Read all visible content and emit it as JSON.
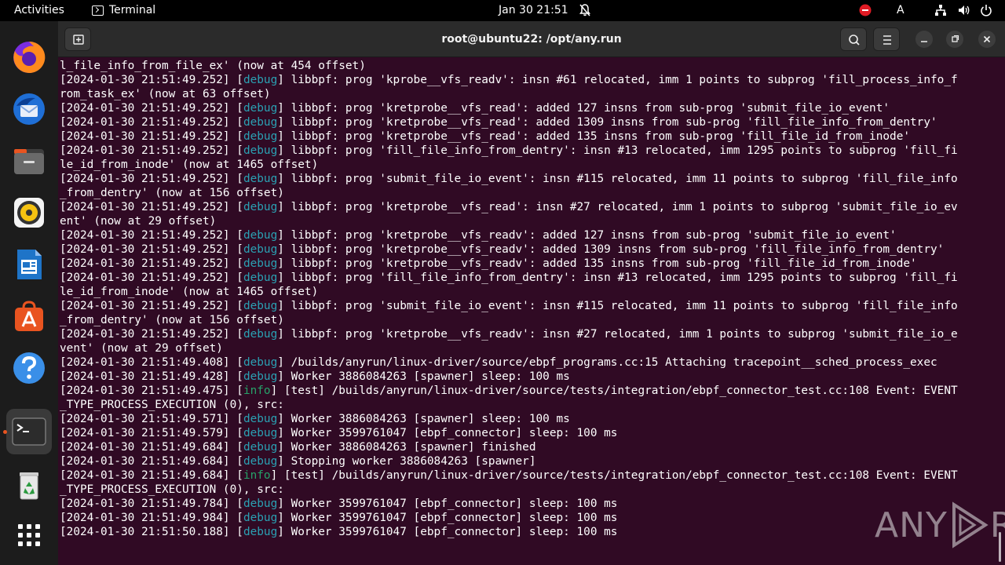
{
  "topbar": {
    "activities": "Activities",
    "app_name": "Terminal",
    "clock": "Jan 30  21:51",
    "icons": [
      "bell-icon",
      "status-red-icon",
      "input-method-icon",
      "network-icon",
      "volume-icon",
      "power-icon"
    ],
    "input_method": "A"
  },
  "dock": {
    "items": [
      {
        "name": "firefox",
        "icon": "firefox-icon"
      },
      {
        "name": "thunderbird",
        "icon": "thunderbird-icon"
      },
      {
        "name": "files",
        "icon": "files-icon"
      },
      {
        "name": "rhythmbox",
        "icon": "rhythmbox-icon"
      },
      {
        "name": "writer",
        "icon": "writer-icon"
      },
      {
        "name": "software",
        "icon": "software-center-icon"
      },
      {
        "name": "help",
        "icon": "help-icon"
      },
      {
        "name": "terminal",
        "icon": "terminal-icon",
        "active": true
      },
      {
        "name": "trash",
        "icon": "trash-icon"
      },
      {
        "name": "apps",
        "icon": "show-apps-icon"
      }
    ]
  },
  "window": {
    "title": "root@ubuntu22: /opt/any.run"
  },
  "colors": {
    "terminal_bg": "#300a24",
    "debug": "#2aa1b3",
    "info": "#26a269",
    "accent": "#e95420"
  },
  "terminal": {
    "lines": [
      {
        "plain": "l_file_info_from_file_ex' (now at 454 offset)"
      },
      {
        "ts": "[2024-01-30 21:51:49.252] ",
        "lvl": "debug",
        "msg": " libbpf: prog 'kprobe__vfs_readv': insn #61 relocated, imm 1 points to subprog 'fill_process_info_f"
      },
      {
        "plain": "rom_task_ex' (now at 63 offset)"
      },
      {
        "ts": "[2024-01-30 21:51:49.252] ",
        "lvl": "debug",
        "msg": " libbpf: prog 'kretprobe__vfs_read': added 127 insns from sub-prog 'submit_file_io_event'"
      },
      {
        "ts": "[2024-01-30 21:51:49.252] ",
        "lvl": "debug",
        "msg": " libbpf: prog 'kretprobe__vfs_read': added 1309 insns from sub-prog 'fill_file_info_from_dentry'"
      },
      {
        "ts": "[2024-01-30 21:51:49.252] ",
        "lvl": "debug",
        "msg": " libbpf: prog 'kretprobe__vfs_read': added 135 insns from sub-prog 'fill_file_id_from_inode'"
      },
      {
        "ts": "[2024-01-30 21:51:49.252] ",
        "lvl": "debug",
        "msg": " libbpf: prog 'fill_file_info_from_dentry': insn #13 relocated, imm 1295 points to subprog 'fill_fi"
      },
      {
        "plain": "le_id_from_inode' (now at 1465 offset)"
      },
      {
        "ts": "[2024-01-30 21:51:49.252] ",
        "lvl": "debug",
        "msg": " libbpf: prog 'submit_file_io_event': insn #115 relocated, imm 11 points to subprog 'fill_file_info"
      },
      {
        "plain": "_from_dentry' (now at 156 offset)"
      },
      {
        "ts": "[2024-01-30 21:51:49.252] ",
        "lvl": "debug",
        "msg": " libbpf: prog 'kretprobe__vfs_read': insn #27 relocated, imm 1 points to subprog 'submit_file_io_ev"
      },
      {
        "plain": "ent' (now at 29 offset)"
      },
      {
        "ts": "[2024-01-30 21:51:49.252] ",
        "lvl": "debug",
        "msg": " libbpf: prog 'kretprobe__vfs_readv': added 127 insns from sub-prog 'submit_file_io_event'"
      },
      {
        "ts": "[2024-01-30 21:51:49.252] ",
        "lvl": "debug",
        "msg": " libbpf: prog 'kretprobe__vfs_readv': added 1309 insns from sub-prog 'fill_file_info_from_dentry'"
      },
      {
        "ts": "[2024-01-30 21:51:49.252] ",
        "lvl": "debug",
        "msg": " libbpf: prog 'kretprobe__vfs_readv': added 135 insns from sub-prog 'fill_file_id_from_inode'"
      },
      {
        "ts": "[2024-01-30 21:51:49.252] ",
        "lvl": "debug",
        "msg": " libbpf: prog 'fill_file_info_from_dentry': insn #13 relocated, imm 1295 points to subprog 'fill_fi"
      },
      {
        "plain": "le_id_from_inode' (now at 1465 offset)"
      },
      {
        "ts": "[2024-01-30 21:51:49.252] ",
        "lvl": "debug",
        "msg": " libbpf: prog 'submit_file_io_event': insn #115 relocated, imm 11 points to subprog 'fill_file_info"
      },
      {
        "plain": "_from_dentry' (now at 156 offset)"
      },
      {
        "ts": "[2024-01-30 21:51:49.252] ",
        "lvl": "debug",
        "msg": " libbpf: prog 'kretprobe__vfs_readv': insn #27 relocated, imm 1 points to subprog 'submit_file_io_e"
      },
      {
        "plain": "vent' (now at 29 offset)"
      },
      {
        "ts": "[2024-01-30 21:51:49.408] ",
        "lvl": "debug",
        "msg": " /builds/anyrun/linux-driver/source/ebpf_programs.cc:15 Attaching tracepoint__sched_process_exec"
      },
      {
        "ts": "[2024-01-30 21:51:49.428] ",
        "lvl": "debug",
        "msg": " Worker 3886084263 [spawner] sleep: 100 ms"
      },
      {
        "ts": "[2024-01-30 21:51:49.475] ",
        "lvl": "info",
        "msg": " [test] /builds/anyrun/linux-driver/source/tests/integration/ebpf_connector_test.cc:108 Event: EVENT"
      },
      {
        "plain": "_TYPE_PROCESS_EXECUTION (0), src:"
      },
      {
        "ts": "[2024-01-30 21:51:49.571] ",
        "lvl": "debug",
        "msg": " Worker 3886084263 [spawner] sleep: 100 ms"
      },
      {
        "ts": "[2024-01-30 21:51:49.579] ",
        "lvl": "debug",
        "msg": " Worker 3599761047 [ebpf_connector] sleep: 100 ms"
      },
      {
        "ts": "[2024-01-30 21:51:49.684] ",
        "lvl": "debug",
        "msg": " Worker 3886084263 [spawner] finished"
      },
      {
        "ts": "[2024-01-30 21:51:49.684] ",
        "lvl": "debug",
        "msg": " Stopping worker 3886084263 [spawner]"
      },
      {
        "ts": "[2024-01-30 21:51:49.684] ",
        "lvl": "info",
        "msg": " [test] /builds/anyrun/linux-driver/source/tests/integration/ebpf_connector_test.cc:108 Event: EVENT"
      },
      {
        "plain": "_TYPE_PROCESS_EXECUTION (0), src:"
      },
      {
        "ts": "[2024-01-30 21:51:49.784] ",
        "lvl": "debug",
        "msg": " Worker 3599761047 [ebpf_connector] sleep: 100 ms"
      },
      {
        "ts": "[2024-01-30 21:51:49.984] ",
        "lvl": "debug",
        "msg": " Worker 3599761047 [ebpf_connector] sleep: 100 ms"
      },
      {
        "ts": "[2024-01-30 21:51:50.188] ",
        "lvl": "debug",
        "msg": " Worker 3599761047 [ebpf_connector] sleep: 100 ms"
      }
    ]
  },
  "watermark": {
    "left": "ANY",
    "right": "RUN"
  }
}
